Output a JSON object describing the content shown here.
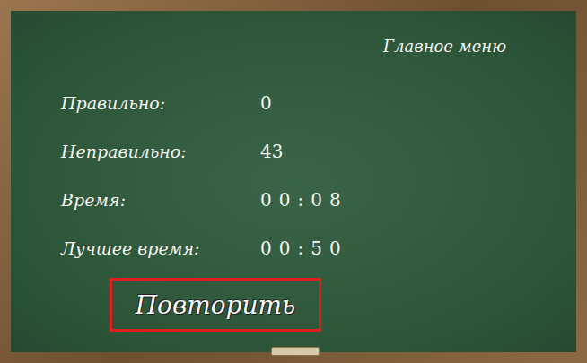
{
  "menu_link": "Главное меню",
  "stats": [
    {
      "label": "Правильно:",
      "value": "0"
    },
    {
      "label": "Неправильно:",
      "value": "43"
    },
    {
      "label": "Время:",
      "value": "00:08"
    },
    {
      "label": "Лучшее время:",
      "value": "00:50"
    }
  ],
  "buttons": [
    "Повторить"
  ]
}
